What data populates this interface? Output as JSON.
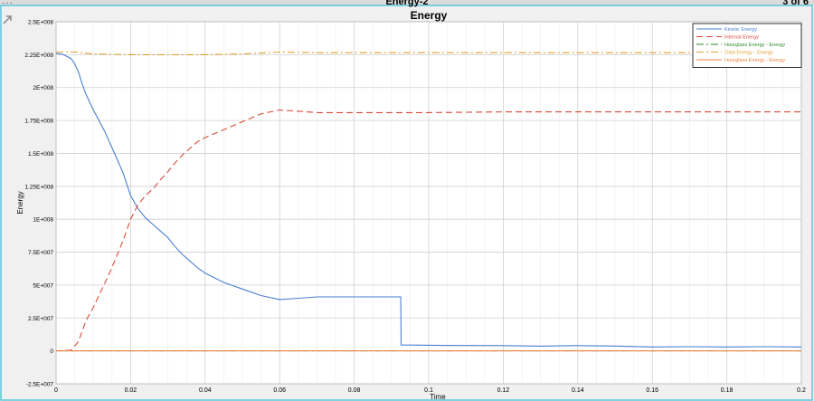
{
  "window": {
    "title": "Energy-2",
    "page_indicator": "3 of 6",
    "menu_dots": "···"
  },
  "colors": {
    "background": "#ffffff",
    "grid": "#d0d0d0",
    "frame_border": "#55c8d8",
    "kinetic": "#4a7fd0",
    "internal": "#d84a3a",
    "hourglass": "#2e8b2e",
    "total": "#e0a030",
    "hourglass2": "#f08040"
  },
  "chart_data": {
    "type": "line",
    "title": "Energy",
    "xlabel": "Time",
    "ylabel": "Energy",
    "xlim": [
      0,
      0.2
    ],
    "ylim": [
      -25000000,
      250000000
    ],
    "xticks": [
      0,
      0.02,
      0.04,
      0.06,
      0.08,
      0.1,
      0.12,
      0.14,
      0.16,
      0.18,
      0.2
    ],
    "xtick_labels": [
      "0",
      "0.02",
      "0.04",
      "0.06",
      "0.08",
      "0.1",
      "0.12",
      "0.14",
      "0.16",
      "0.18",
      "0.2"
    ],
    "yticks": [
      -25000000,
      0,
      25000000,
      50000000,
      75000000,
      100000000,
      125000000,
      150000000,
      175000000,
      200000000,
      225000000,
      250000000
    ],
    "ytick_labels": [
      "-2.5E+007",
      "0",
      "2.5E+007",
      "5E+007",
      "7.5E+007",
      "1E+008",
      "1.25E+008",
      "1.5E+008",
      "1.75E+008",
      "2E+008",
      "2.25E+008",
      "2.5E+008"
    ],
    "grid": true,
    "legend_position": "top-right",
    "series": [
      {
        "name": "Kinetic Energy",
        "color": "#4a7fd0",
        "dash": "",
        "x": [
          0,
          0.002,
          0.004,
          0.005,
          0.006,
          0.007,
          0.008,
          0.01,
          0.013,
          0.016,
          0.018,
          0.02,
          0.022,
          0.024,
          0.026,
          0.028,
          0.03,
          0.032,
          0.034,
          0.036,
          0.038,
          0.04,
          0.045,
          0.05,
          0.055,
          0.06,
          0.065,
          0.07,
          0.075,
          0.08,
          0.085,
          0.09,
          0.0925,
          0.0926,
          0.1,
          0.11,
          0.12,
          0.13,
          0.14,
          0.15,
          0.16,
          0.17,
          0.18,
          0.19,
          0.2
        ],
        "y": [
          226000000,
          225000000,
          222000000,
          218000000,
          212000000,
          203000000,
          195000000,
          183000000,
          167000000,
          148000000,
          135000000,
          118000000,
          108000000,
          101000000,
          96000000,
          91000000,
          86000000,
          79000000,
          73000000,
          68000000,
          63000000,
          59000000,
          52000000,
          47000000,
          42000000,
          39000000,
          40000000,
          41000000,
          41000000,
          41000000,
          41000000,
          41000000,
          41000000,
          4500000,
          4300000,
          4100000,
          4000000,
          3600000,
          4000000,
          3700000,
          3000000,
          3200000,
          3000000,
          3200000,
          3000000
        ]
      },
      {
        "name": "Internal Energy",
        "color": "#d84a3a",
        "dash": "7,4",
        "x": [
          0,
          0.004,
          0.006,
          0.008,
          0.01,
          0.012,
          0.014,
          0.016,
          0.018,
          0.02,
          0.022,
          0.024,
          0.026,
          0.028,
          0.03,
          0.032,
          0.034,
          0.036,
          0.038,
          0.04,
          0.045,
          0.05,
          0.055,
          0.06,
          0.065,
          0.07,
          0.08,
          0.1,
          0.12,
          0.14,
          0.16,
          0.18,
          0.2
        ],
        "y": [
          0,
          500000,
          7000000,
          23000000,
          33000000,
          45000000,
          57000000,
          70000000,
          84000000,
          100000000,
          111000000,
          118000000,
          123000000,
          130000000,
          136000000,
          143000000,
          149000000,
          154000000,
          159000000,
          162000000,
          168000000,
          174000000,
          180000000,
          183000000,
          182000000,
          181000000,
          181000000,
          181000000,
          181500000,
          181500000,
          181500000,
          181500000,
          181500000
        ]
      },
      {
        "name": "Hourglass Energy - Energy",
        "color": "#2e8b2e",
        "dash": "8,3,2,3",
        "x": [
          0,
          0.2
        ],
        "y": [
          0,
          0
        ]
      },
      {
        "name": "Total Energy - Energy",
        "color": "#e0a030",
        "dash": "8,3,2,3",
        "x": [
          0,
          0.005,
          0.01,
          0.02,
          0.03,
          0.04,
          0.05,
          0.06,
          0.07,
          0.08,
          0.1,
          0.12,
          0.14,
          0.16,
          0.18,
          0.2
        ],
        "y": [
          227000000,
          227000000,
          225500000,
          225000000,
          225000000,
          225000000,
          225500000,
          227000000,
          226500000,
          226500000,
          226500000,
          226500000,
          226500000,
          226500000,
          226500000,
          226500000
        ]
      },
      {
        "name": "Hourglass Energy - Energy",
        "color": "#f08040",
        "dash": "",
        "x": [
          0,
          0.2
        ],
        "y": [
          0,
          0
        ]
      }
    ]
  },
  "legend": {
    "entries": [
      {
        "label": "Kinetic Energy",
        "color": "#4a7fd0",
        "dash": ""
      },
      {
        "label": "Internal Energy",
        "color": "#d84a3a",
        "dash": "7,4"
      },
      {
        "label": "Hourglass Energy - Energy",
        "color": "#2e8b2e",
        "dash": "8,3,2,3"
      },
      {
        "label": "Total Energy - Energy",
        "color": "#e0a030",
        "dash": "8,3,2,3"
      },
      {
        "label": "Hourglass Energy - Energy",
        "color": "#f08040",
        "dash": ""
      }
    ]
  }
}
